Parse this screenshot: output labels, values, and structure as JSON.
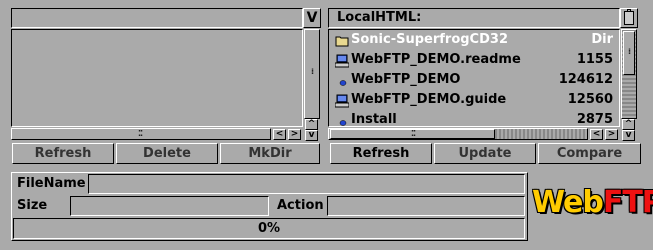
{
  "left_pane": {
    "path": "",
    "dropdown_label": "V",
    "buttons": [
      "Refresh",
      "Delete",
      "MkDir"
    ]
  },
  "right_pane": {
    "path": "LocalHTML:",
    "files": [
      {
        "name": "Sonic-SuperfrogCD32",
        "size": "Dir",
        "date": "0",
        "icon": "folder-icon",
        "dim": true
      },
      {
        "name": "WebFTP_DEMO.readme",
        "size": "1155",
        "date": "1",
        "icon": "computer-icon",
        "dim": false
      },
      {
        "name": "WebFTP_DEMO",
        "size": "124612",
        "date": "1",
        "icon": "program-icon",
        "dim": false
      },
      {
        "name": "WebFTP_DEMO.guide",
        "size": "12560",
        "date": "1",
        "icon": "computer-icon",
        "dim": false
      },
      {
        "name": "Install",
        "size": "2875",
        "date": "2",
        "icon": "program-icon",
        "dim": false
      }
    ],
    "buttons": [
      "Refresh",
      "Update",
      "Compare"
    ]
  },
  "transfer": {
    "filename_label": "FileName",
    "filename_value": "",
    "size_label": "Size",
    "size_value": "",
    "action_label": "Action",
    "action_value": "",
    "progress_text": "0%",
    "progress": 0
  },
  "logo": {
    "part1": "Web",
    "part2": "FTP",
    "color1": "#ffcc00",
    "color2": "#ee1111"
  },
  "scroll_arrows": {
    "left": "<",
    "right": ">",
    "up": "^",
    "down": "v"
  }
}
